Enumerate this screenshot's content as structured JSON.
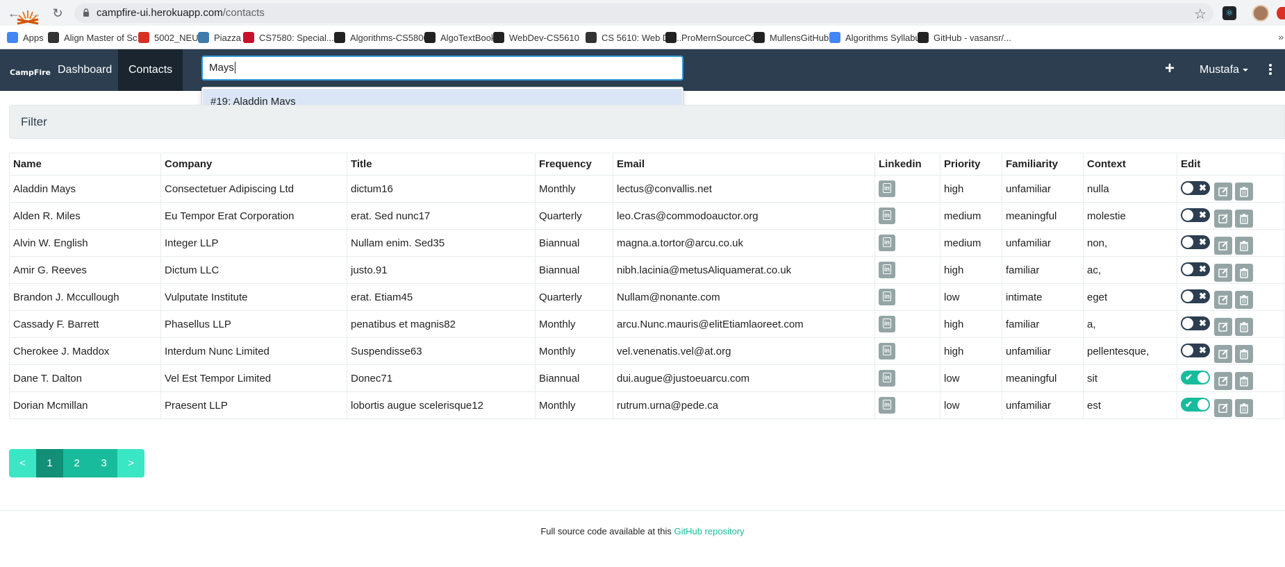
{
  "browser": {
    "url_host": "campfire-ui.herokuapp.com",
    "url_path": "/contacts",
    "bookmarks": [
      {
        "label": "Apps",
        "icon": "apps-grid-icon",
        "color": "#4285f4"
      },
      {
        "label": "Align Master of Sc...",
        "icon": "globe-icon",
        "color": "#333333"
      },
      {
        "label": "5002_NEU",
        "icon": "circle-dashed-icon",
        "color": "#d93025"
      },
      {
        "label": "Piazza",
        "icon": "piazza-icon",
        "color": "#3e7aab"
      },
      {
        "label": "CS7580: Special...",
        "icon": "northeastern-n-icon",
        "color": "#c8102e"
      },
      {
        "label": "Algorithms-CS5800",
        "icon": "blackboard-icon",
        "color": "#222222"
      },
      {
        "label": "AlgoTextBook",
        "icon": "github-icon",
        "color": "#222222"
      },
      {
        "label": "WebDev-CS5610",
        "icon": "blackboard-icon",
        "color": "#222222"
      },
      {
        "label": "CS 5610: Web De...",
        "icon": "globe-icon",
        "color": "#333333"
      },
      {
        "label": "ProMernSourceCo...",
        "icon": "github-icon",
        "color": "#222222"
      },
      {
        "label": "MullensGitHub",
        "icon": "github-icon",
        "color": "#222222"
      },
      {
        "label": "Algorithms Syllabus",
        "icon": "google-doc-icon",
        "color": "#4285f4"
      },
      {
        "label": "GitHub - vasansr/...",
        "icon": "github-icon",
        "color": "#222222"
      }
    ],
    "more_label": "»"
  },
  "navbar": {
    "logo_text": "CampFire",
    "links": [
      "Dashboard",
      "Contacts"
    ],
    "active_link": "Contacts",
    "search_value": "Mays",
    "suggestion": "#19: Aladdin Mays",
    "plus_label": "+",
    "user_name": "Mustafa"
  },
  "filter": {
    "title": "Filter"
  },
  "table": {
    "headers": [
      "Name",
      "Company",
      "Title",
      "Frequency",
      "Email",
      "Linkedin",
      "Priority",
      "Familiarity",
      "Context",
      "Edit"
    ],
    "rows": [
      {
        "name": "Aladdin Mays",
        "company": "Consectetuer Adipiscing Ltd",
        "title": "dictum16",
        "frequency": "Monthly",
        "email": "lectus@convallis.net",
        "priority": "high",
        "familiarity": "unfamiliar",
        "context": "nulla",
        "active": false
      },
      {
        "name": "Alden R. Miles",
        "company": "Eu Tempor Erat Corporation",
        "title": "erat. Sed nunc17",
        "frequency": "Quarterly",
        "email": "leo.Cras@commodoauctor.org",
        "priority": "medium",
        "familiarity": "meaningful",
        "context": "molestie",
        "active": false
      },
      {
        "name": "Alvin W. English",
        "company": "Integer LLP",
        "title": "Nullam enim. Sed35",
        "frequency": "Biannual",
        "email": "magna.a.tortor@arcu.co.uk",
        "priority": "medium",
        "familiarity": "unfamiliar",
        "context": "non,",
        "active": false
      },
      {
        "name": "Amir G. Reeves",
        "company": "Dictum LLC",
        "title": "justo.91",
        "frequency": "Biannual",
        "email": "nibh.lacinia@metusAliquamerat.co.uk",
        "priority": "high",
        "familiarity": "familiar",
        "context": "ac,",
        "active": false
      },
      {
        "name": "Brandon J. Mccullough",
        "company": "Vulputate Institute",
        "title": "erat. Etiam45",
        "frequency": "Quarterly",
        "email": "Nullam@nonante.com",
        "priority": "low",
        "familiarity": "intimate",
        "context": "eget",
        "active": false
      },
      {
        "name": "Cassady F. Barrett",
        "company": "Phasellus LLP",
        "title": "penatibus et magnis82",
        "frequency": "Monthly",
        "email": "arcu.Nunc.mauris@elitEtiamlaoreet.com",
        "priority": "high",
        "familiarity": "familiar",
        "context": "a,",
        "active": false
      },
      {
        "name": "Cherokee J. Maddox",
        "company": "Interdum Nunc Limited",
        "title": "Suspendisse63",
        "frequency": "Monthly",
        "email": "vel.venenatis.vel@at.org",
        "priority": "high",
        "familiarity": "unfamiliar",
        "context": "pellentesque,",
        "active": false
      },
      {
        "name": "Dane T. Dalton",
        "company": "Vel Est Tempor Limited",
        "title": "Donec71",
        "frequency": "Biannual",
        "email": "dui.augue@justoeuarcu.com",
        "priority": "low",
        "familiarity": "meaningful",
        "context": "sit",
        "active": true
      },
      {
        "name": "Dorian Mcmillan",
        "company": "Praesent LLP",
        "title": "lobortis augue scelerisque12",
        "frequency": "Monthly",
        "email": "rutrum.urna@pede.ca",
        "priority": "low",
        "familiarity": "unfamiliar",
        "context": "est",
        "active": true
      }
    ]
  },
  "pagination": {
    "prev": "<",
    "pages": [
      "1",
      "2",
      "3"
    ],
    "current": "1",
    "next": ">"
  },
  "footer": {
    "text": "Full source code available at this ",
    "link_text": "GitHub repository"
  },
  "colors": {
    "navbar": "#2c3e50",
    "accent": "#18bc9c",
    "search_border": "#3498db",
    "suggestion_bg": "#dae6f5"
  }
}
